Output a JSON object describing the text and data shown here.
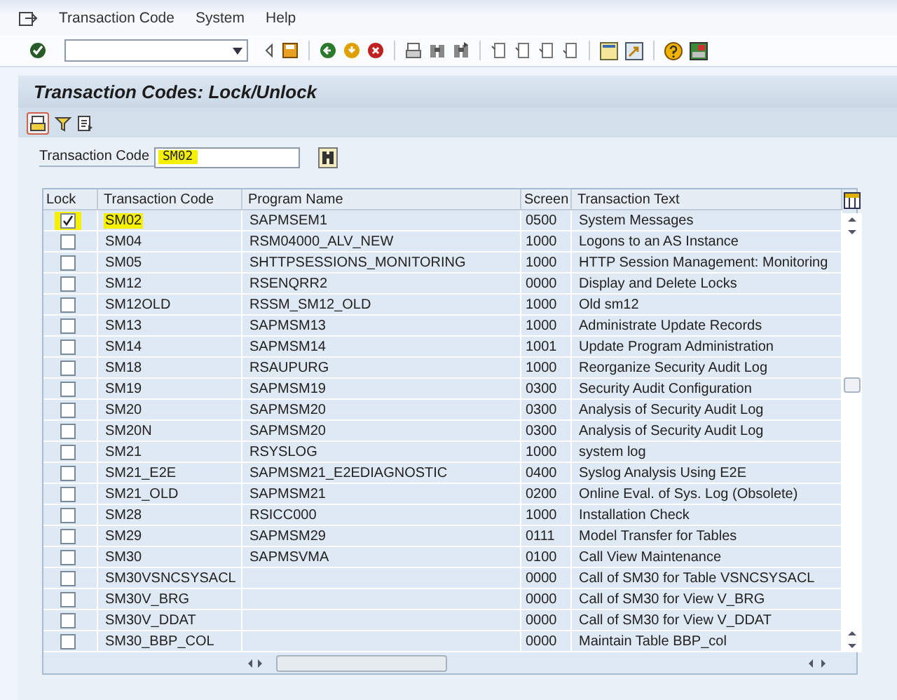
{
  "menu": [
    "Transaction Code",
    "System",
    "Help"
  ],
  "title": "Transaction Codes: Lock/Unlock",
  "selection": {
    "label": "Transaction Code",
    "value": "SM02",
    "highlighted": true
  },
  "table": {
    "columns": [
      "Lock",
      "Transaction Code",
      "Program Name",
      "Screen",
      "Transaction Text"
    ],
    "rows": [
      {
        "locked": true,
        "highlighted": true,
        "code": "SM02",
        "program": "SAPMSEM1",
        "screen": "0500",
        "text": "System Messages"
      },
      {
        "locked": false,
        "highlighted": false,
        "code": "SM04",
        "program": "RSM04000_ALV_NEW",
        "screen": "1000",
        "text": "Logons to an AS Instance"
      },
      {
        "locked": false,
        "highlighted": false,
        "code": "SM05",
        "program": "SHTTPSESSIONS_MONITORING",
        "screen": "1000",
        "text": "HTTP Session Management: Monitoring"
      },
      {
        "locked": false,
        "highlighted": false,
        "code": "SM12",
        "program": "RSENQRR2",
        "screen": "0000",
        "text": "Display and Delete Locks"
      },
      {
        "locked": false,
        "highlighted": false,
        "code": "SM12OLD",
        "program": "RSSM_SM12_OLD",
        "screen": "1000",
        "text": "Old sm12"
      },
      {
        "locked": false,
        "highlighted": false,
        "code": "SM13",
        "program": "SAPMSM13",
        "screen": "1000",
        "text": "Administrate Update Records"
      },
      {
        "locked": false,
        "highlighted": false,
        "code": "SM14",
        "program": "SAPMSM14",
        "screen": "1001",
        "text": "Update Program Administration"
      },
      {
        "locked": false,
        "highlighted": false,
        "code": "SM18",
        "program": "RSAUPURG",
        "screen": "1000",
        "text": "Reorganize Security Audit Log"
      },
      {
        "locked": false,
        "highlighted": false,
        "code": "SM19",
        "program": "SAPMSM19",
        "screen": "0300",
        "text": "Security Audit Configuration"
      },
      {
        "locked": false,
        "highlighted": false,
        "code": "SM20",
        "program": "SAPMSM20",
        "screen": "0300",
        "text": "Analysis of Security Audit Log"
      },
      {
        "locked": false,
        "highlighted": false,
        "code": "SM20N",
        "program": "SAPMSM20",
        "screen": "0300",
        "text": "Analysis of Security Audit Log"
      },
      {
        "locked": false,
        "highlighted": false,
        "code": "SM21",
        "program": "RSYSLOG",
        "screen": "1000",
        "text": "system log"
      },
      {
        "locked": false,
        "highlighted": false,
        "code": "SM21_E2E",
        "program": "SAPMSM21_E2EDIAGNOSTIC",
        "screen": "0400",
        "text": "Syslog Analysis Using E2E"
      },
      {
        "locked": false,
        "highlighted": false,
        "code": "SM21_OLD",
        "program": "SAPMSM21",
        "screen": "0200",
        "text": "Online Eval. of Sys. Log (Obsolete)"
      },
      {
        "locked": false,
        "highlighted": false,
        "code": "SM28",
        "program": "RSICC000",
        "screen": "1000",
        "text": "Installation Check"
      },
      {
        "locked": false,
        "highlighted": false,
        "code": "SM29",
        "program": "SAPMSM29",
        "screen": "0111",
        "text": "Model Transfer for Tables"
      },
      {
        "locked": false,
        "highlighted": false,
        "code": "SM30",
        "program": "SAPMSVMA",
        "screen": "0100",
        "text": "Call View Maintenance"
      },
      {
        "locked": false,
        "highlighted": false,
        "code": "SM30VSNCSYSACL",
        "screen": "0000",
        "text": "Call of SM30 for Table VSNCSYSACL"
      },
      {
        "locked": false,
        "highlighted": false,
        "code": "SM30V_BRG",
        "screen": "0000",
        "text": "Call of SM30 for View V_BRG"
      },
      {
        "locked": false,
        "highlighted": false,
        "code": "SM30V_DDAT",
        "screen": "0000",
        "text": "Call of SM30 for View V_DDAT"
      },
      {
        "locked": false,
        "highlighted": false,
        "code": "SM30_BBP_COL",
        "screen": "0000",
        "text": "Maintain Table BBP_col"
      }
    ]
  }
}
